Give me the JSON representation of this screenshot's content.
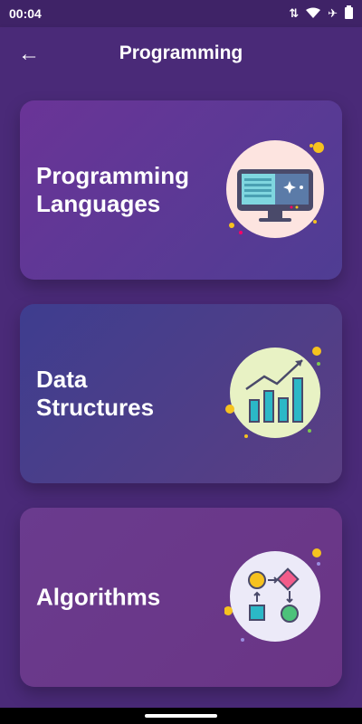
{
  "status": {
    "time": "00:04"
  },
  "appbar": {
    "title": "Programming"
  },
  "cards": [
    {
      "label": "Programming Languages"
    },
    {
      "label": "Data Structures"
    },
    {
      "label": "Algorithms"
    }
  ],
  "icons": {
    "back": "arrow-left-icon",
    "card1": "computer-monitor-icon",
    "card2": "bar-chart-growth-icon",
    "card3": "algorithm-flow-icon"
  },
  "colors": {
    "background": "#4a2a78",
    "statusbar": "#3f2367",
    "accent_yellow": "#f6c21f",
    "accent_teal": "#2bb8c7"
  }
}
